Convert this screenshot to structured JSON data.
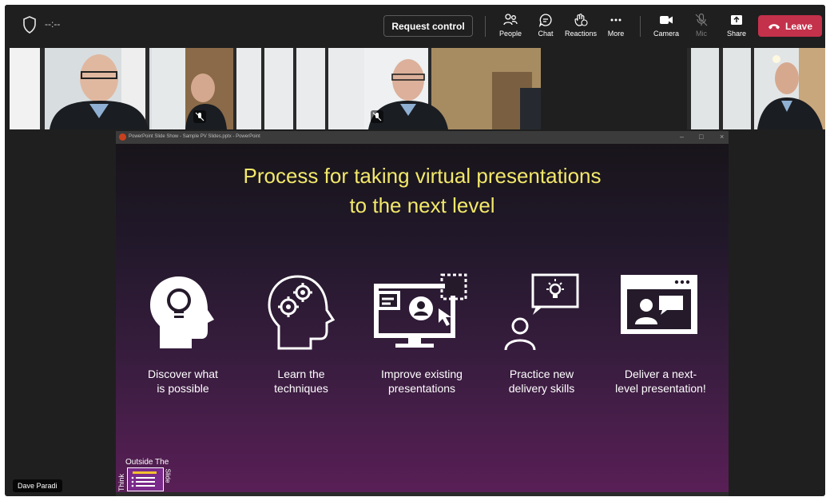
{
  "meeting": {
    "timer": "--:--"
  },
  "toolbar": {
    "request_control_label": "Request control",
    "people_label": "People",
    "chat_label": "Chat",
    "reactions_label": "Reactions",
    "more_label": "More",
    "camera_label": "Camera",
    "mic_label": "Mic",
    "share_label": "Share",
    "leave_label": "Leave"
  },
  "share_window": {
    "title": "PowerPoint Slide Show - Sample PV Slides.pptx - PowerPoint"
  },
  "slide": {
    "title_line1": "Process for taking virtual presentations",
    "title_line2": "to the next level",
    "steps": [
      {
        "line1": "Discover what",
        "line2": "is possible",
        "icon": "lightbulb-head-icon"
      },
      {
        "line1": "Learn the",
        "line2": "techniques",
        "icon": "gears-head-icon"
      },
      {
        "line1": "Improve existing",
        "line2": "presentations",
        "icon": "monitor-edit-icon"
      },
      {
        "line1": "Practice new",
        "line2": "delivery skills",
        "icon": "person-idea-icon"
      },
      {
        "line1": "Deliver a next-",
        "line2": "level presentation!",
        "icon": "web-presenter-icon"
      }
    ],
    "logo": {
      "line1": "Outside The",
      "side_left": "Think",
      "side_right": "Slide"
    }
  },
  "participant": {
    "name": "Dave Paradi"
  },
  "colors": {
    "leave": "#c4314b",
    "slide_title": "#f2e86a",
    "logo_purple": "#7a2a8a"
  }
}
